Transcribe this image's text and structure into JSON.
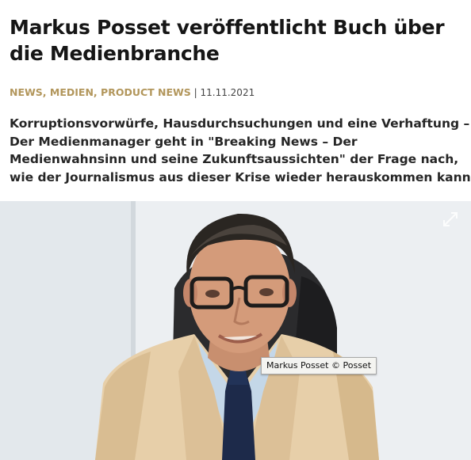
{
  "article": {
    "title_lines": [
      "Markus Posset veröffentlicht Buch über",
      "die Medienbranche"
    ],
    "categories": [
      "NEWS",
      "MEDIEN",
      "PRODUCT NEWS"
    ],
    "category_separator": ", ",
    "meta_separator": " | ",
    "date": "11.11.2021",
    "lead_lines": [
      "Korruptionsvorwürfe, Hausdurchsuchungen und eine Verhaftung –",
      "Der Medienmanager geht in \"Breaking News – Der",
      "Medienwahnsinn und seine Zukunftsaussichten\" der Frage nach,",
      "wie der Journalismus aus dieser Krise wieder herauskommen kann."
    ],
    "image": {
      "alt": "Markus Posset",
      "caption": "Markus Posset © Posset",
      "expand_icon": "expand-arrows-icon"
    }
  }
}
